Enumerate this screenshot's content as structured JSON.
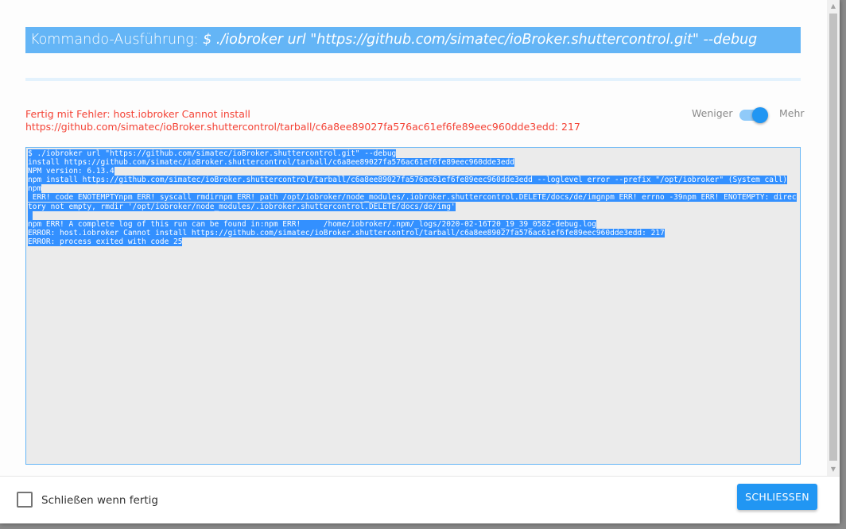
{
  "dialog": {
    "title_prefix": "Kommando-Ausführung: ",
    "title_command": "$ ./iobroker url \"https://github.com/simatec/ioBroker.shuttercontrol.git\" --debug",
    "status_message": "Fertig mit Fehler: host.iobroker Cannot install https://github.com/simatec/ioBroker.shuttercontrol/tarball/c6a8ee89027fa576ac61ef6fe89eec960dde3edd: 217",
    "toggle": {
      "less_label": "Weniger",
      "more_label": "Mehr",
      "state": "Mehr"
    },
    "log_lines": [
      "$ ./iobroker url \"https://github.com/simatec/ioBroker.shuttercontrol.git\" --debug",
      "install https://github.com/simatec/ioBroker.shuttercontrol/tarball/c6a8ee89027fa576ac61ef6fe89eec960dde3edd",
      "NPM version: 6.13.4",
      "npm install https://github.com/simatec/ioBroker.shuttercontrol/tarball/c6a8ee89027fa576ac61ef6fe89eec960dde3edd --loglevel error --prefix \"/opt/iobroker\" (System call)",
      "npm",
      " ERR! code ENOTEMPTYnpm ERR! syscall rmdirnpm ERR! path /opt/iobroker/node_modules/.iobroker.shuttercontrol.DELETE/docs/de/imgnpm ERR! errno -39npm ERR! ENOTEMPTY: directory not empty, rmdir '/opt/iobroker/node_modules/.iobroker.shuttercontrol.DELETE/docs/de/img'",
      " ",
      "npm ERR! A complete log of this run can be found in:npm ERR!     /home/iobroker/.npm/_logs/2020-02-16T20_19_39_058Z-debug.log",
      "ERROR: host.iobroker Cannot install https://github.com/simatec/ioBroker.shuttercontrol/tarball/c6a8ee89027fa576ac61ef6fe89eec960dde3edd: 217",
      "ERROR: process exited with code 25"
    ]
  },
  "footer": {
    "auto_close_label": "Schließen wenn fertig",
    "auto_close_checked": false,
    "close_button_label": "SCHLIESSEN"
  },
  "scrollbar": {
    "up_icon": "arrow-up-icon",
    "down_icon": "arrow-down-icon"
  },
  "colors": {
    "accent": "#2196f3",
    "title_bg": "#64b5f6",
    "error_text": "#f44336",
    "selection": "#3390ff"
  }
}
